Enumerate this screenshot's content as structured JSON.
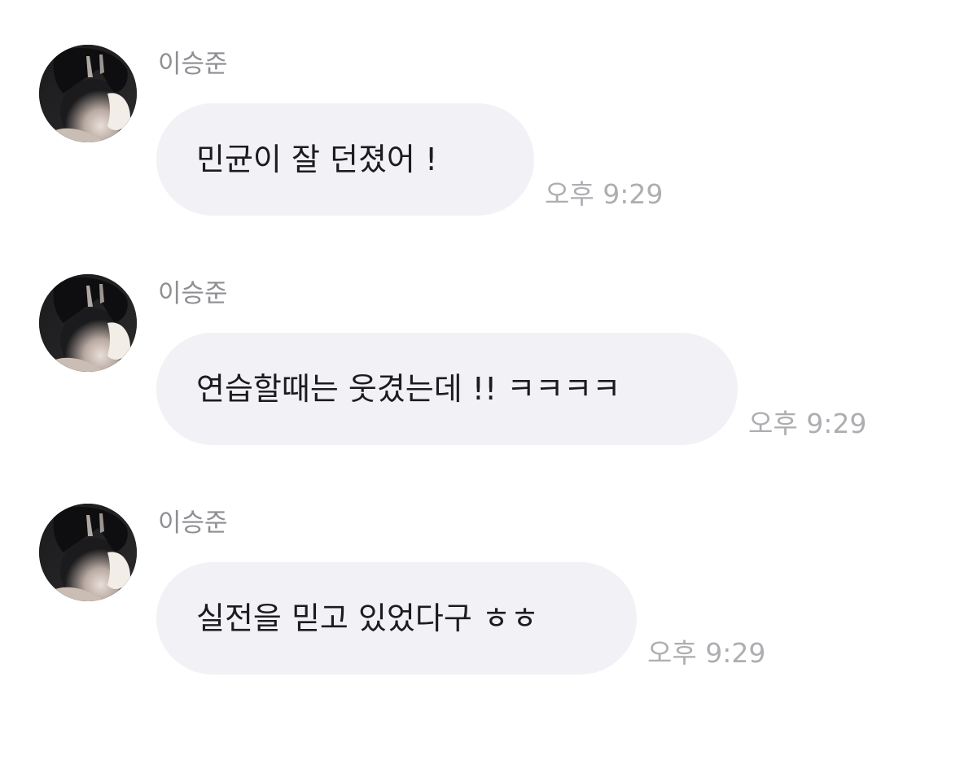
{
  "messages": [
    {
      "sender": "이승준",
      "avatar_icon": "profile-photo",
      "text": "민균이 잘 던졌어 !",
      "time": "오후 9:29"
    },
    {
      "sender": "이승준",
      "avatar_icon": "profile-photo",
      "text": "연습할때는 웃겼는데 !! ㅋㅋㅋㅋ",
      "time": "오후 9:29"
    },
    {
      "sender": "이승준",
      "avatar_icon": "profile-photo",
      "text": "실전을 믿고 있었다구 ㅎㅎ",
      "time": "오후 9:29"
    }
  ],
  "colors": {
    "background": "#ffffff",
    "bubble": "#f2f2f6",
    "sender_name": "#8e8e93",
    "timestamp": "#aeaeb2",
    "message_text": "#1c1c1e"
  }
}
